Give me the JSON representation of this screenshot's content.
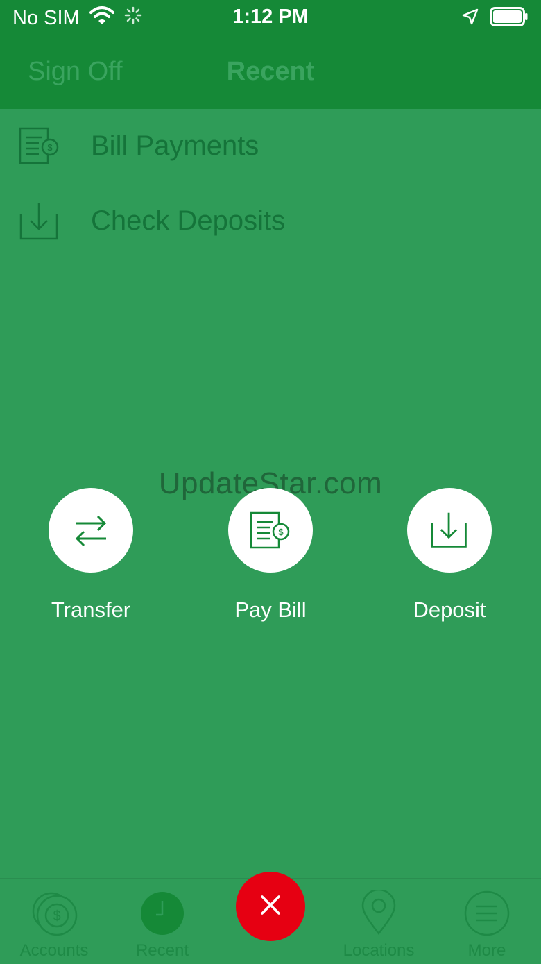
{
  "status_bar": {
    "carrier": "No SIM",
    "time": "1:12 PM"
  },
  "nav": {
    "left_label": "Sign Off",
    "title": "Recent"
  },
  "recent_items": [
    {
      "label": "Bill Payments",
      "icon": "bill-icon"
    },
    {
      "label": "Check Deposits",
      "icon": "deposit-icon"
    }
  ],
  "watermark": "UpdateStar.com",
  "quick_actions": [
    {
      "label": "Transfer",
      "icon": "transfer-icon"
    },
    {
      "label": "Pay Bill",
      "icon": "bill-icon"
    },
    {
      "label": "Deposit",
      "icon": "deposit-icon"
    }
  ],
  "tabs": [
    {
      "label": "Accounts",
      "icon": "accounts-icon"
    },
    {
      "label": "Recent",
      "icon": "clock-icon"
    },
    {
      "label": "",
      "icon": "close-icon"
    },
    {
      "label": "Locations",
      "icon": "location-pin-icon"
    },
    {
      "label": "More",
      "icon": "menu-icon"
    }
  ],
  "colors": {
    "brand_green": "#158937",
    "overlay_green": "#2f9c58",
    "close_red": "#e60012"
  }
}
